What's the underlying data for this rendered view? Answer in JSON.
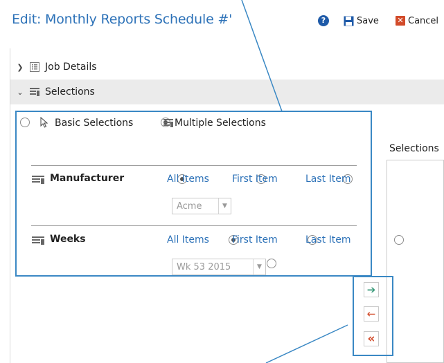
{
  "header": {
    "title": "Edit: Monthly Reports Schedule #'",
    "help_icon": "?",
    "save_label": "Save",
    "cancel_label": "Cancel"
  },
  "sections": {
    "job_details": "Job Details",
    "selections": "Selections"
  },
  "modes": {
    "basic": "Basic Selections",
    "multiple": "Multiple Selections",
    "selected": "multiple"
  },
  "filters": [
    {
      "name": "Manufacturer",
      "options": [
        "All Items",
        "First Item",
        "Last Item"
      ],
      "selected": "All Items",
      "dropdown_value": "Acme"
    },
    {
      "name": "Weeks",
      "options": [
        "All Items",
        "First Item",
        "Last Item"
      ],
      "selected": "All Items",
      "dropdown_value": "Wk 53 2015"
    }
  ],
  "selections_list": {
    "label": "Selections"
  },
  "arrow_buttons": {
    "add_symbol": "➔",
    "remove_symbol": "←",
    "remove_all_symbol": "«"
  },
  "colors": {
    "accent": "#2d72b8",
    "highlight_box": "#3a88c4",
    "save": "#1e5aa8",
    "cancel": "#d24b2a",
    "add_arrow": "#3a9a7a",
    "remove_arrow": "#d24b2a"
  },
  "icons": {
    "help": "help-icon",
    "save": "floppy-disk-icon",
    "cancel": "close-box-icon",
    "job_details": "list-icon",
    "selections": "multi-list-icon",
    "pointer": "cursor-arrow-icon"
  }
}
